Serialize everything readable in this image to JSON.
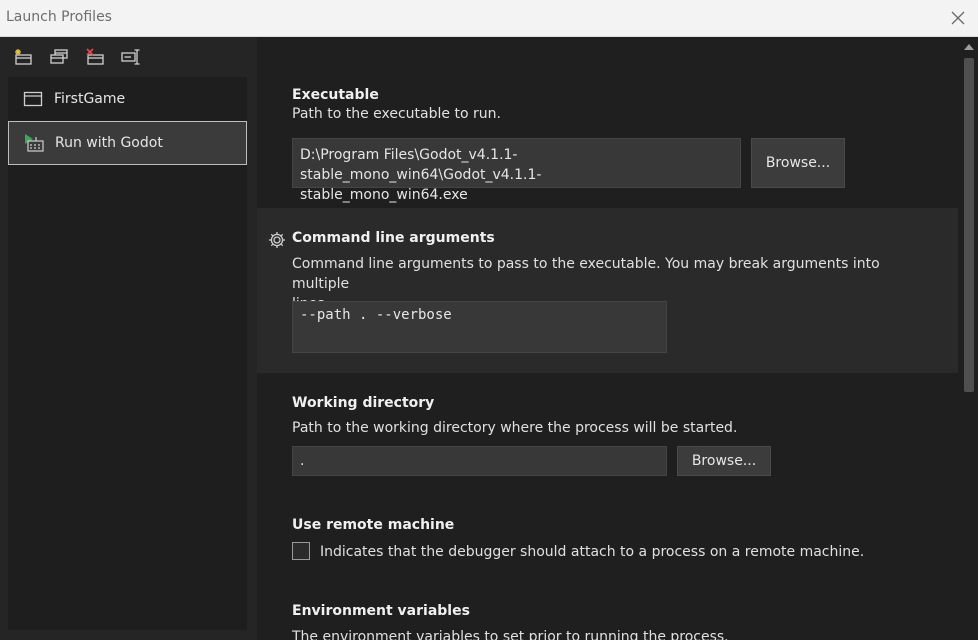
{
  "window": {
    "title": "Launch Profiles",
    "close_icon": "close-icon"
  },
  "toolbar": {
    "icons": [
      "new-profile-icon",
      "duplicate-profile-icon",
      "delete-profile-icon",
      "rename-profile-icon"
    ]
  },
  "profiles": [
    {
      "label": "FirstGame",
      "icon": "window-icon",
      "selected": false
    },
    {
      "label": "Run with Godot",
      "icon": "godot-run-icon",
      "selected": true
    }
  ],
  "executable": {
    "title": "Executable",
    "description": "Path to the executable to run.",
    "value_line1": "D:\\Program Files\\Godot_v4.1.1-stable_mono_win64\\Godot_v4.1.1-",
    "value_line2": "stable_mono_win64.exe",
    "browse_label": "Browse..."
  },
  "arguments": {
    "title": "Command line arguments",
    "description_line1": "Command line arguments to pass to the executable. You may break arguments into multiple",
    "description_line2": "lines.",
    "value": "--path . --verbose",
    "icon": "gear-icon"
  },
  "working_directory": {
    "title": "Working directory",
    "description": "Path to the working directory where the process will be started.",
    "value": ".",
    "browse_label": "Browse..."
  },
  "remote_machine": {
    "title": "Use remote machine",
    "checkbox_label": "Indicates that the debugger should attach to a process on a remote machine.",
    "checked": false
  },
  "environment": {
    "title": "Environment variables",
    "description": "The environment variables to set prior to running the process."
  },
  "colors": {
    "background": "#1f1f1f",
    "left_pane": "#252526",
    "alt_section": "#2a2a2a",
    "field": "#383838",
    "button": "#3c3c3c",
    "godot_accent": "#3ea55a"
  }
}
